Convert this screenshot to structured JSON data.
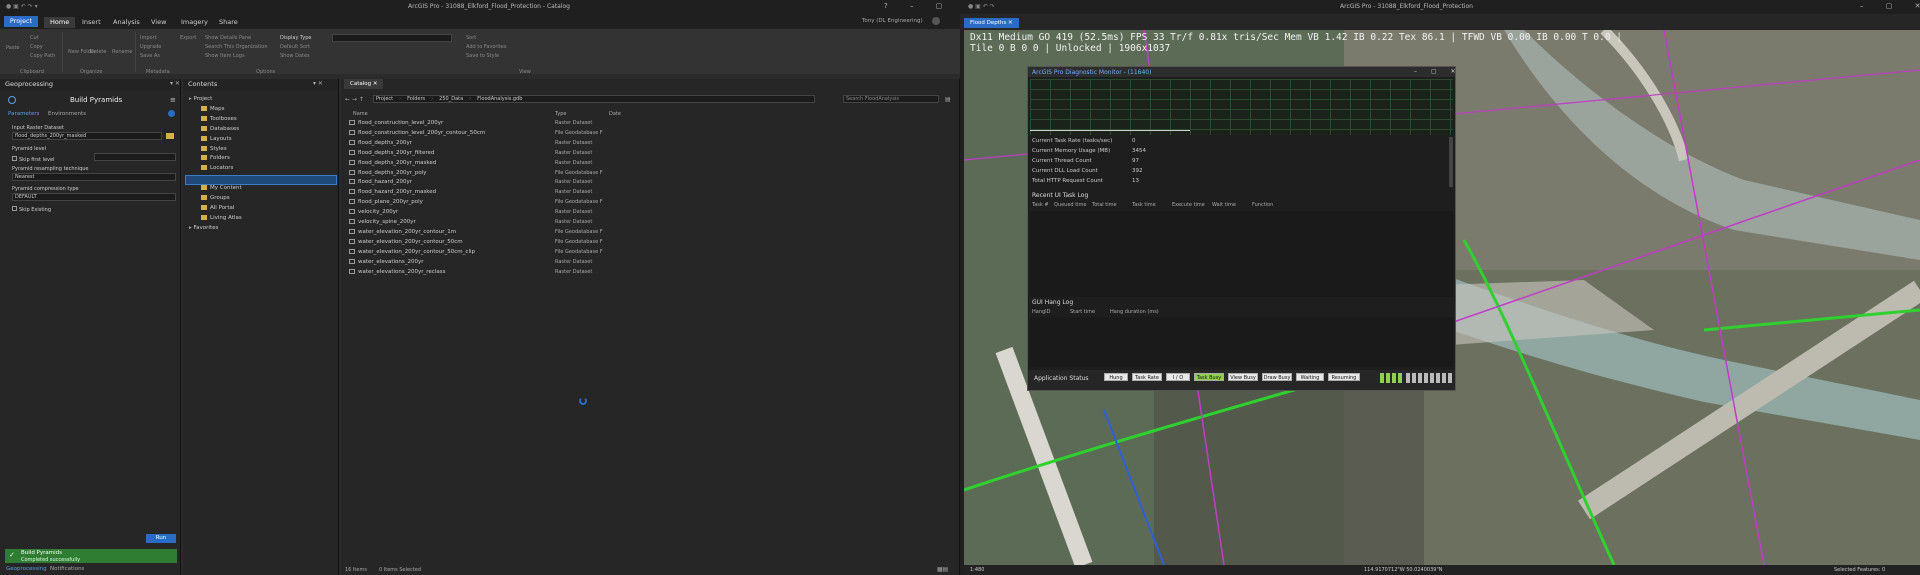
{
  "left_window": {
    "title": "ArcGIS Pro - 31088_Elkford_Flood_Protection - Catalog",
    "project_tab": "Project",
    "tabs": [
      "Home",
      "Insert",
      "Analysis",
      "View",
      "Imagery",
      "Share"
    ],
    "user": "Tony (DL Engineering)",
    "ribbon": {
      "clipboard_items": [
        "Paste",
        "Cut",
        "Copy",
        "Copy Path"
      ],
      "organize_items": [
        "New Folder",
        "Delete",
        "Rename"
      ],
      "options_items": [
        "Import",
        "Upgrade",
        "Save As",
        "Export",
        "Show Details Pane",
        "Search This Organization",
        "Show Item Logs",
        "Display Type",
        "Default Sort",
        "Show Dates",
        "Sort",
        "Add to Favorites",
        "Save to Style"
      ],
      "group_labels": [
        "Clipboard",
        "Organize",
        "Metadata",
        "Options",
        "View"
      ]
    },
    "geoprocessing": {
      "header": "Geoprocessing",
      "tool_title": "Build Pyramids",
      "tab_parameters": "Parameters",
      "tab_environments": "Environments",
      "input_label": "Input Raster Dataset",
      "input_value": "flood_depths_200yr_masked",
      "pyramid_level_label": "Pyramid level",
      "skip_first_label": "Skip first level",
      "resampling_label": "Pyramid resampling technique",
      "resampling_value": "Nearest",
      "compression_label": "Pyramid compression type",
      "compression_value": "DEFAULT",
      "skip_existing_label": "Skip Existing",
      "run_label": "Run",
      "status_title": "Build Pyramids",
      "status_message": "Completed successfully",
      "bottom_tabs": [
        "Geoprocessing",
        "Notifications"
      ]
    },
    "contents": {
      "header": "Contents",
      "tree": [
        {
          "label": "Project",
          "level": 0
        },
        {
          "label": "Maps",
          "level": 1
        },
        {
          "label": "Toolboxes",
          "level": 1
        },
        {
          "label": "Databases",
          "level": 1
        },
        {
          "label": "Layouts",
          "level": 1
        },
        {
          "label": "Styles",
          "level": 1
        },
        {
          "label": "Folders",
          "level": 1
        },
        {
          "label": "Locators",
          "level": 1
        },
        {
          "label": "Portal",
          "level": 0
        },
        {
          "label": "My Content",
          "level": 1
        },
        {
          "label": "Groups",
          "level": 1
        },
        {
          "label": "All Portal",
          "level": 1
        },
        {
          "label": "Living Atlas",
          "level": 1
        },
        {
          "label": "Favorites",
          "level": 0
        }
      ]
    },
    "catalog": {
      "tab": "Catalog",
      "breadcrumb": [
        "Project",
        "Folders",
        "250_Data",
        "FloodAnalysis.gdb"
      ],
      "search_placeholder": "Search FloodAnalysis",
      "columns": [
        "Name",
        "Type",
        "Date"
      ],
      "rows": [
        {
          "name": "flood_construction_level_200yr",
          "type": "Raster Dataset"
        },
        {
          "name": "flood_construction_level_200yr_contour_50cm",
          "type": "File Geodatabase F"
        },
        {
          "name": "flood_depths_200yr",
          "type": "Raster Dataset"
        },
        {
          "name": "flood_depths_200yr_filtered",
          "type": "Raster Dataset"
        },
        {
          "name": "flood_depths_200yr_masked",
          "type": "Raster Dataset"
        },
        {
          "name": "flood_depths_200yr_poly",
          "type": "File Geodatabase F"
        },
        {
          "name": "flood_hazard_200yr",
          "type": "Raster Dataset"
        },
        {
          "name": "flood_hazard_200yr_masked",
          "type": "Raster Dataset"
        },
        {
          "name": "flood_plane_200yr_poly",
          "type": "File Geodatabase F"
        },
        {
          "name": "velocity_200yr",
          "type": "Raster Dataset"
        },
        {
          "name": "velocity_spine_200yr",
          "type": "Raster Dataset"
        },
        {
          "name": "water_elevation_200yr_contour_1m",
          "type": "File Geodatabase F"
        },
        {
          "name": "water_elevation_200yr_contour_50cm",
          "type": "File Geodatabase F"
        },
        {
          "name": "water_elevation_200yr_contour_50cm_clip",
          "type": "File Geodatabase F"
        },
        {
          "name": "water_elevations_200yr",
          "type": "Raster Dataset"
        },
        {
          "name": "water_elevations_200yr_reclass",
          "type": "Raster Dataset"
        }
      ],
      "status_items": "16 Items",
      "status_selected": "0 Items Selected"
    }
  },
  "right_window": {
    "title": "ArcGIS Pro - 31088_Elkford_Flood_Protection",
    "map_tab": "Flood Depths",
    "overlay_line1": "Dx11 Medium GO 419 (52.5ms) FPS 33 Tr/f 0.81x tris/Sec  Mem VB 1.42 IB 0.22 Tex 86.1 | TFWD VB 0.00 IB 0.00 T 0.0 |",
    "overlay_line2": "Tile 0 B 0 0 | Unlocked | 1906x1037",
    "scale": "1:480",
    "coords": "114.9170712\"W 50.0240039\"N",
    "selected_features": "Selected Features: 0",
    "diagnostic": {
      "title": "ArcGIS Pro Diagnostic Monitor - (11640)",
      "metrics": [
        {
          "label": "Current Task Rate (tasks/sec)",
          "value": "0"
        },
        {
          "label": "Current Memory Usage (MB)",
          "value": "3454"
        },
        {
          "label": "Current Thread Count",
          "value": "97"
        },
        {
          "label": "Current DLL Load Count",
          "value": "392"
        },
        {
          "label": "Total HTTP Request Count",
          "value": "13"
        }
      ],
      "task_log_title": "Recent UI Task Log",
      "task_log_columns": [
        "Task #",
        "Queued time",
        "Total time",
        "Task time",
        "Execute time",
        "Wait time",
        "Function"
      ],
      "hang_log_title": "GUI Hang Log",
      "hang_log_columns": [
        "HangID",
        "Start time",
        "Hang duration (ms)"
      ],
      "status_label": "Application Status",
      "status_buttons": [
        {
          "label": "Hung",
          "color": "#e8e8e8"
        },
        {
          "label": "Task Rate",
          "color": "#e8e8e8"
        },
        {
          "label": "I / O",
          "color": "#e8e8e8"
        },
        {
          "label": "Task Busy",
          "color": "#8fd14f"
        },
        {
          "label": "View Busy",
          "color": "#e8e8e8"
        },
        {
          "label": "Draw Busy",
          "color": "#e8e8e8"
        },
        {
          "label": "Waiting",
          "color": "#e8e8e8"
        },
        {
          "label": "Resuming",
          "color": "#e8e8e8"
        }
      ]
    }
  },
  "colors": {
    "accent": "#2a6cc4",
    "success": "#2e7d32",
    "task_busy": "#8fd14f"
  }
}
